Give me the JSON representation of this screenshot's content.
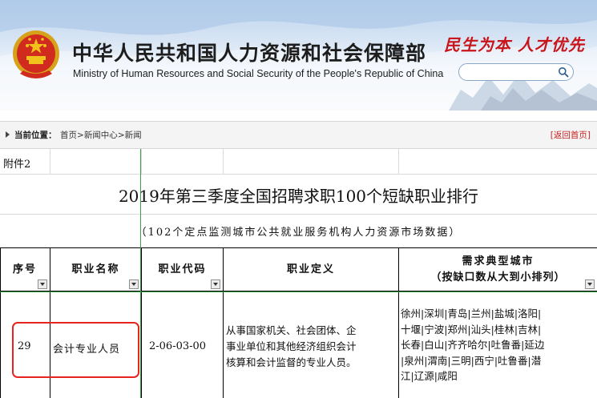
{
  "header": {
    "ministry_cn": "中华人民共和国人力资源和社会保障部",
    "ministry_en": "Ministry of Human Resources and Social Security of the People's Republic of China",
    "slogan": "民生为本 人才优先",
    "search_placeholder": "",
    "emblem_icon": "national-emblem-icon",
    "search_icon": "search-icon"
  },
  "breadcrumb": {
    "label": "当前位置：",
    "items": [
      "首页",
      "新闻中心",
      "新闻"
    ],
    "separator": ">",
    "back_link": "[返回首页]"
  },
  "sheet": {
    "attachment": "附件2",
    "title": "2019年第三季度全国招聘求职100个短缺职业排行",
    "subtitle": "（102个定点监测城市公共就业服务机构人力资源市场数据）",
    "columns": {
      "seq": "序号",
      "name": "职业名称",
      "code": "职业代码",
      "definition": "职业定义",
      "cities_line1": "需求典型城市",
      "cities_line2": "（按缺口数从大到小排列）"
    },
    "row": {
      "seq": "29",
      "name": "会计专业人员",
      "code": "2-06-03-00",
      "definition_lines": [
        "从事国家机关、社会团体、企",
        "事业单位和其他经济组织会计",
        "核算和会计监督的专业人员。"
      ],
      "cities_lines": [
        "徐州|深圳|青岛|兰州|盐城|洛阳|",
        "十堰|宁波|郑州|汕头|桂林|吉林|",
        "长春|白山|齐齐哈尔|吐鲁番|延边",
        "|泉州|渭南|三明|西宁|吐鲁番|潜",
        "江|辽源|咸阳"
      ]
    }
  },
  "colors": {
    "highlight": "#e8241e",
    "slogan": "#c8141a",
    "freeze_line": "#36a34a",
    "back_link": "#c81f1f"
  }
}
